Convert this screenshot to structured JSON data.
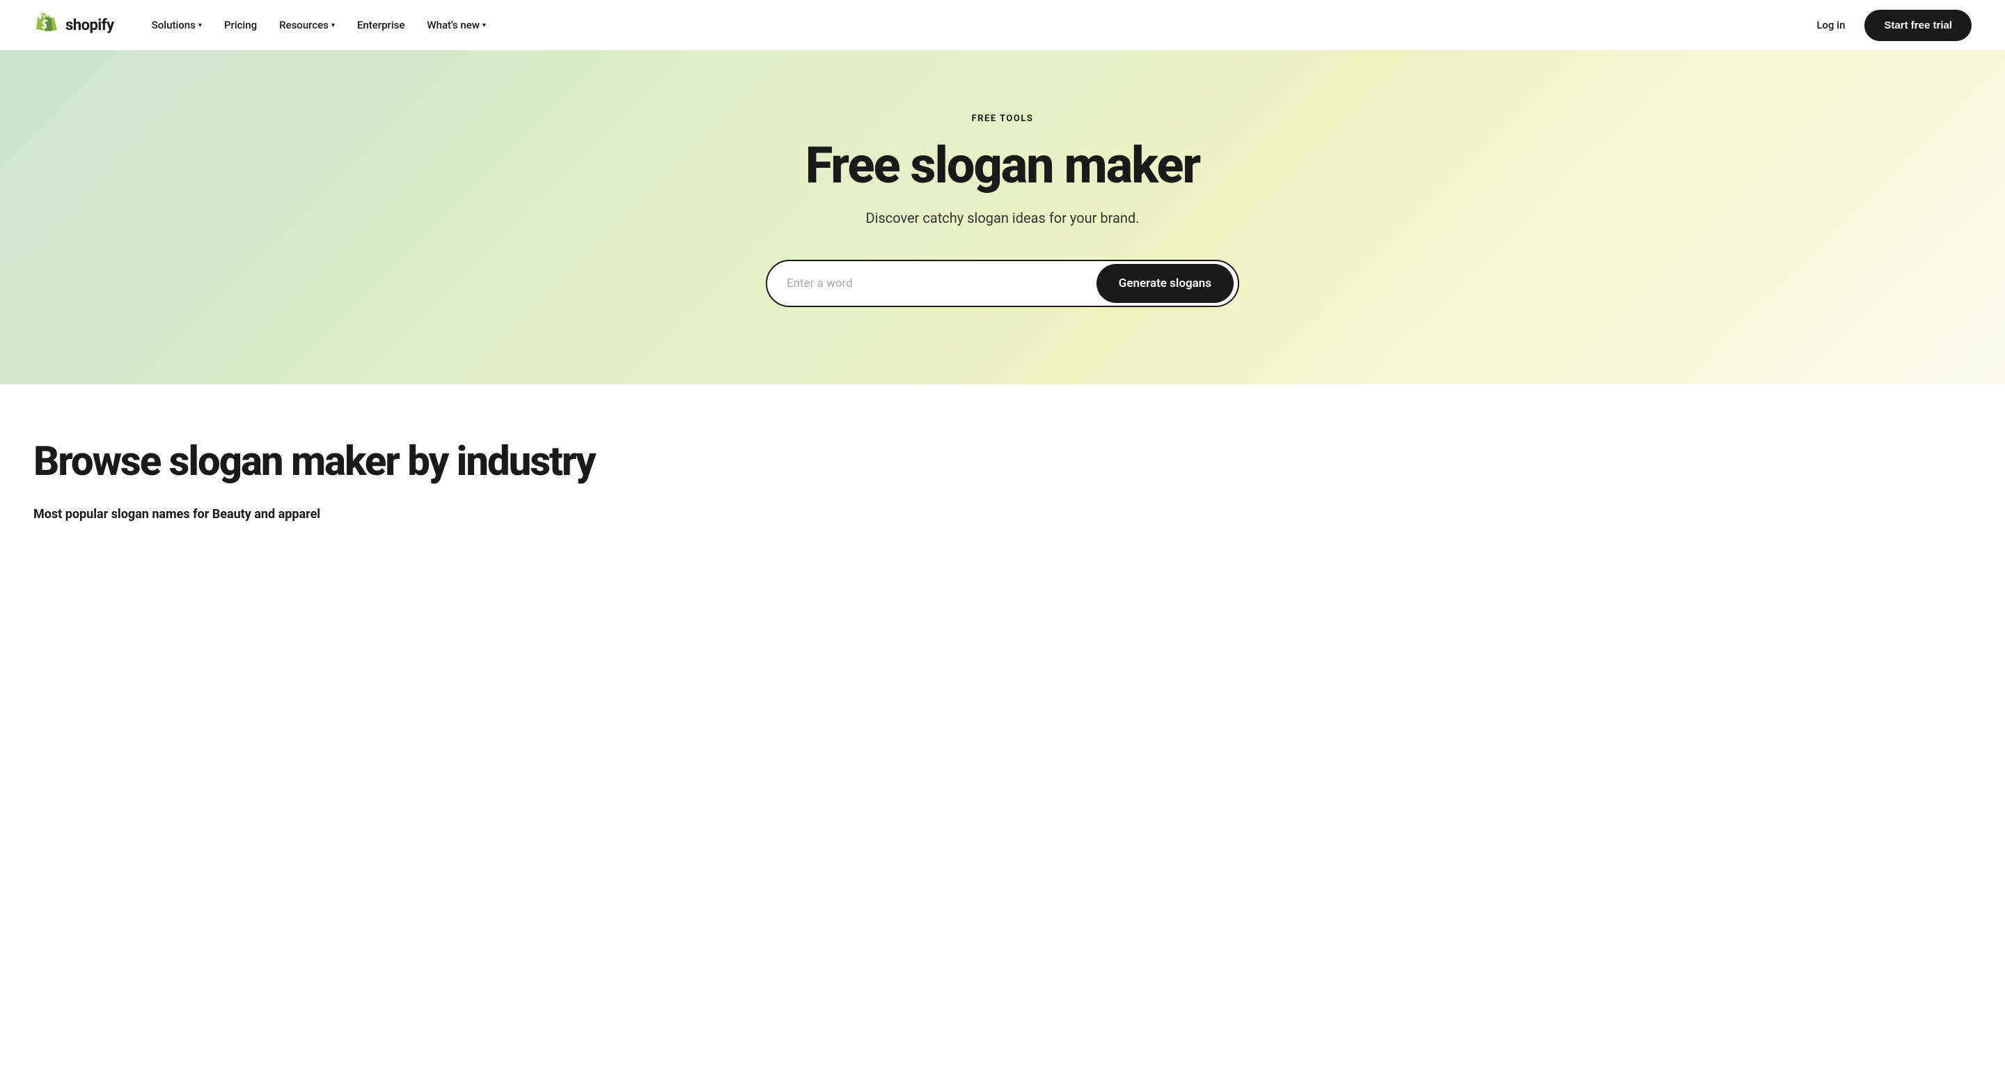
{
  "brand": {
    "logo_alt": "Shopify",
    "logo_text": "shopify"
  },
  "navbar": {
    "links": [
      {
        "label": "Solutions",
        "has_dropdown": true
      },
      {
        "label": "Pricing",
        "has_dropdown": false
      },
      {
        "label": "Resources",
        "has_dropdown": true
      },
      {
        "label": "Enterprise",
        "has_dropdown": false
      },
      {
        "label": "What's new",
        "has_dropdown": true
      }
    ],
    "login_label": "Log in",
    "start_trial_label": "Start free trial"
  },
  "hero": {
    "eyebrow": "FREE TOOLS",
    "title": "Free slogan maker",
    "subtitle": "Discover catchy slogan ideas for your brand.",
    "input_placeholder": "Enter a word",
    "cta_label": "Generate slogans"
  },
  "browse": {
    "title": "Browse slogan maker by industry",
    "subtitle": "Most popular slogan names for Beauty and apparel"
  }
}
